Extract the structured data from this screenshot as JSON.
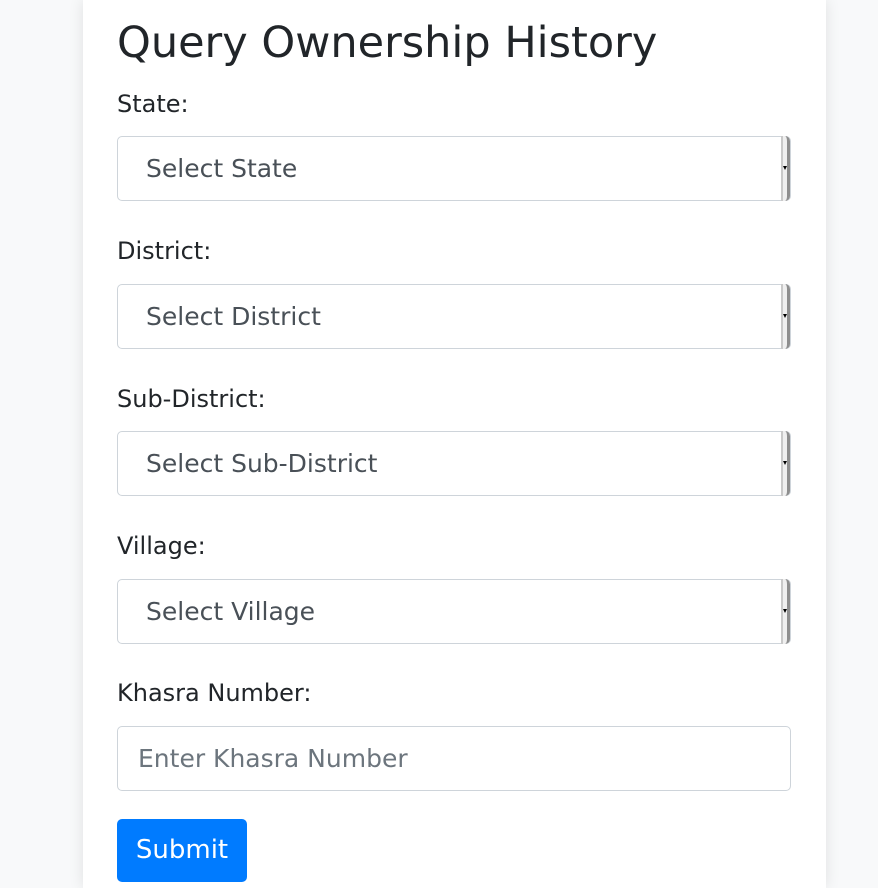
{
  "page": {
    "title": "Query Ownership History"
  },
  "form": {
    "state": {
      "label": "State:",
      "selected": "Select State"
    },
    "district": {
      "label": "District:",
      "selected": "Select District"
    },
    "sub_district": {
      "label": "Sub-District:",
      "selected": "Select Sub-District"
    },
    "village": {
      "label": "Village:",
      "selected": "Select Village"
    },
    "khasra": {
      "label": "Khasra Number:",
      "placeholder": "Enter Khasra Number",
      "value": ""
    },
    "submit_label": "Submit"
  },
  "colors": {
    "primary": "#007bff",
    "text": "#212529",
    "muted_text": "#495057",
    "placeholder": "#6c757d",
    "border": "#ced4da",
    "page_background": "#f8f9fa",
    "card_background": "#ffffff"
  },
  "icons": {
    "select_arrow": "caret-down-icon"
  }
}
